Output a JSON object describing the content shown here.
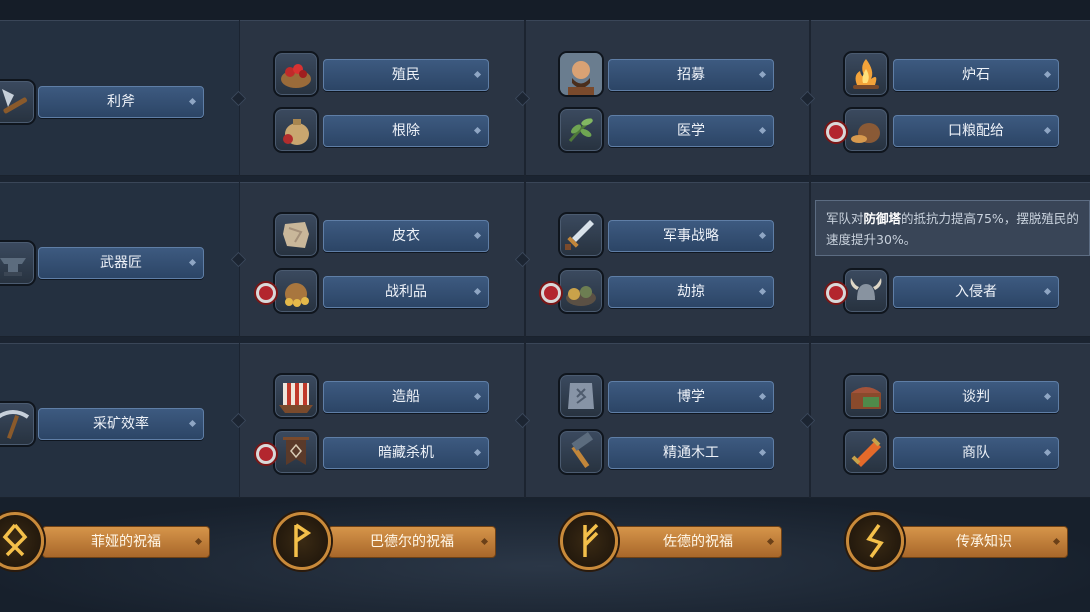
{
  "colors": {
    "panel": "#2a3443",
    "blue_bar": "#34507a",
    "gold_bar": "#c17d3a",
    "lock_red": "#b3262e"
  },
  "rows": [
    {
      "main": {
        "label": "利斧",
        "icon": "axe-icon"
      },
      "cols": [
        [
          {
            "label": "殖民",
            "icon": "berries-bowl-icon",
            "locked": false
          },
          {
            "label": "根除",
            "icon": "sack-icon",
            "locked": false
          }
        ],
        [
          {
            "label": "招募",
            "icon": "warrior-portrait-icon",
            "locked": false
          },
          {
            "label": "医学",
            "icon": "herb-icon",
            "locked": false
          }
        ],
        [
          {
            "label": "炉石",
            "icon": "campfire-icon",
            "locked": false
          },
          {
            "label": "口粮配给",
            "icon": "bread-bag-icon",
            "locked": true
          }
        ]
      ]
    },
    {
      "main": {
        "label": "武器匠",
        "icon": "anvil-icon"
      },
      "cols": [
        [
          {
            "label": "皮衣",
            "icon": "hide-icon",
            "locked": false
          },
          {
            "label": "战利品",
            "icon": "loot-bag-icon",
            "locked": true
          }
        ],
        [
          {
            "label": "军事战略",
            "icon": "sword-icon",
            "locked": false
          },
          {
            "label": "劫掠",
            "icon": "plunder-pile-icon",
            "locked": true
          }
        ],
        [
          {
            "label": "",
            "icon": "",
            "locked": false
          },
          {
            "label": "入侵者",
            "icon": "horned-helmet-icon",
            "locked": true
          }
        ]
      ]
    },
    {
      "main": {
        "label": "采矿效率",
        "icon": "pickaxe-icon"
      },
      "cols": [
        [
          {
            "label": "造船",
            "icon": "longship-icon",
            "locked": false
          },
          {
            "label": "暗藏杀机",
            "icon": "banner-icon",
            "locked": true
          }
        ],
        [
          {
            "label": "博学",
            "icon": "rune-stone-icon",
            "locked": false
          },
          {
            "label": "精通木工",
            "icon": "hammer-icon",
            "locked": false
          }
        ],
        [
          {
            "label": "谈判",
            "icon": "trade-chest-icon",
            "locked": false
          },
          {
            "label": "商队",
            "icon": "scroll-icon",
            "locked": false
          }
        ]
      ]
    }
  ],
  "tooltip": {
    "pre": "军队对",
    "bold": "防御塔",
    "post": "的抵抗力提高75%，摆脱殖民的速度提升30%。"
  },
  "blessings": [
    {
      "label": "菲娅的祝福",
      "icon": "othala-rune-icon"
    },
    {
      "label": "巴德尔的祝福",
      "icon": "wunjo-rune-icon"
    },
    {
      "label": "佐德的祝福",
      "icon": "algiz-rune-icon"
    },
    {
      "label": "传承知识",
      "icon": "sowilo-rune-icon"
    }
  ]
}
